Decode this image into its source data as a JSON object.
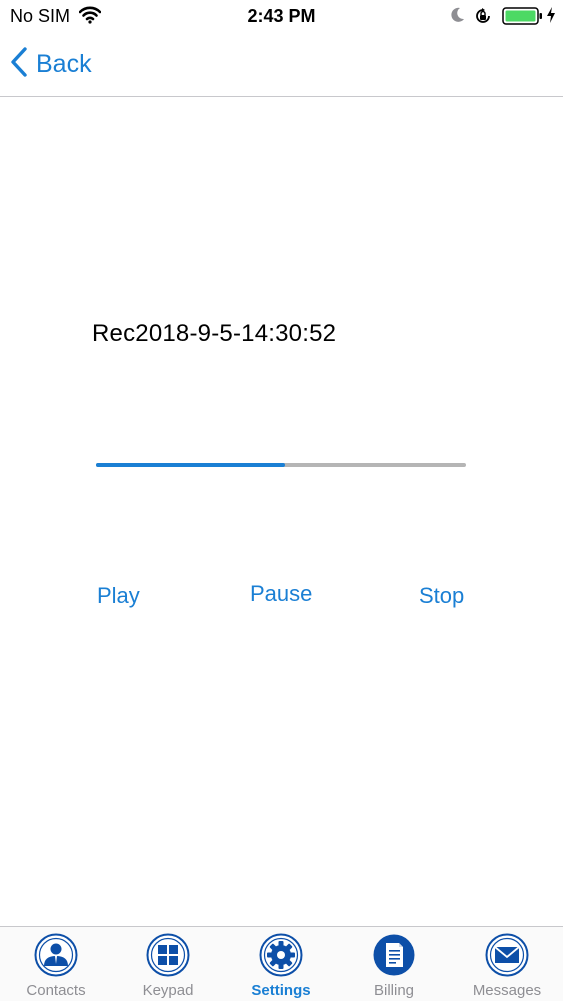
{
  "status_bar": {
    "carrier": "No SIM",
    "time": "2:43 PM",
    "battery_color": "#4cd964",
    "icons": [
      "wifi-icon",
      "moon-icon",
      "orientation-lock-icon",
      "battery-icon",
      "charging-bolt-icon"
    ]
  },
  "nav": {
    "back_label": "Back"
  },
  "recording": {
    "name": "Rec2018-9-5-14:30:52",
    "progress": 0.51
  },
  "controls": {
    "play": "Play",
    "pause": "Pause",
    "stop": "Stop"
  },
  "tabs": [
    {
      "label": "Contacts",
      "icon": "contacts-icon",
      "active": false
    },
    {
      "label": "Keypad",
      "icon": "keypad-icon",
      "active": false
    },
    {
      "label": "Settings",
      "icon": "gear-icon",
      "active": true
    },
    {
      "label": "Billing",
      "icon": "billing-icon",
      "active": false
    },
    {
      "label": "Messages",
      "icon": "envelope-icon",
      "active": false
    }
  ],
  "colors": {
    "accent": "#1a7fd4",
    "icon_blue": "#0d4fa8",
    "inactive": "#8e8e93"
  }
}
